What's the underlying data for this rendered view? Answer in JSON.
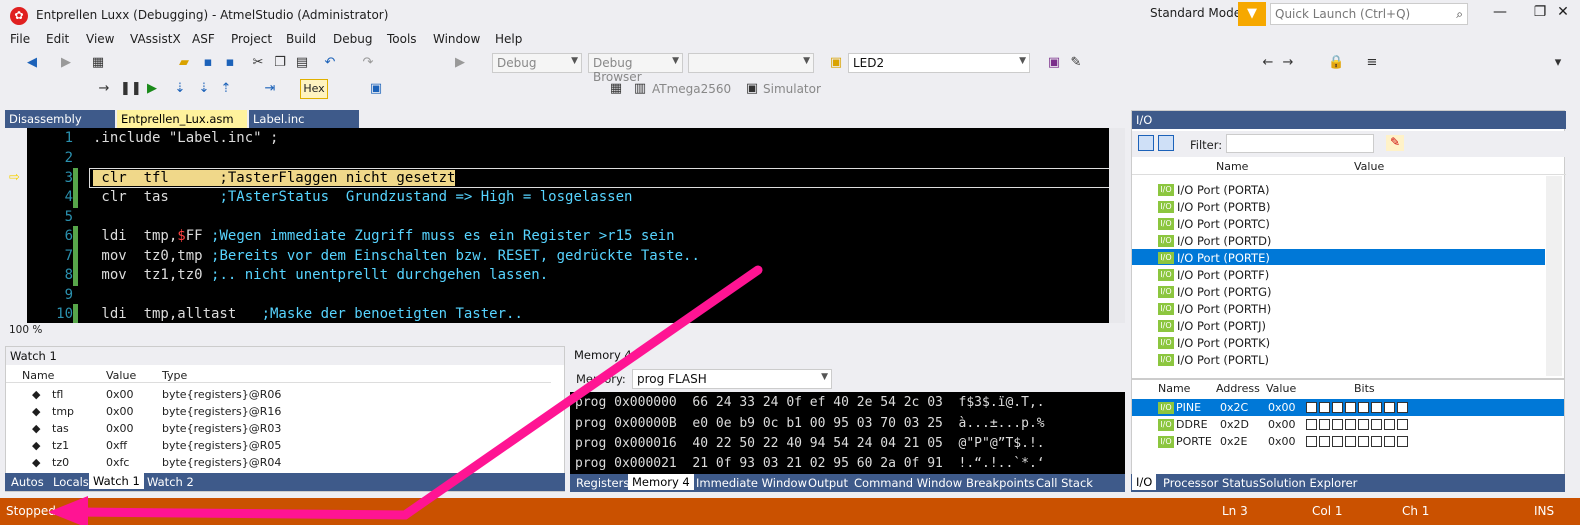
{
  "window": {
    "title": "Entprellen Luxx (Debugging) - AtmelStudio (Administrator)",
    "mode": "Standard Mode",
    "quick_launch": "Quick Launch (Ctrl+Q)"
  },
  "menu": [
    "File",
    "Edit",
    "View",
    "VAssistX",
    "ASF",
    "Project",
    "Build",
    "Debug",
    "Tools",
    "Window",
    "Help"
  ],
  "toolbar": {
    "config": "Debug",
    "browser": "Debug Browser",
    "target": "LED2",
    "hex": "Hex",
    "device": "ATmega2560",
    "tool": "Simulator"
  },
  "tabs": [
    "Disassembly",
    "Entprellen_Lux.asm",
    "Label.inc"
  ],
  "editor": {
    "zoom": "100 %",
    "lines": [
      {
        "n": "1",
        "t": ".include \"Label.inc\" ;"
      },
      {
        "n": "2",
        "t": ""
      },
      {
        "n": "3",
        "t": " clr  tfl      ;TasterFlaggen nicht gesetzt"
      },
      {
        "n": "4",
        "t": " clr  tas      ;TAsterStatus  Grundzustand => High = losgelassen"
      },
      {
        "n": "5",
        "t": ""
      },
      {
        "n": "6",
        "t": " ldi  tmp,$FF ;Wegen immediate Zugriff muss es ein Register >r15 sein"
      },
      {
        "n": "7",
        "t": " mov  tz0,tmp ;Bereits vor dem Einschalten bzw. RESET, gedrückte Taste.."
      },
      {
        "n": "8",
        "t": " mov  tz1,tz0 ;.. nicht unentprellt durchgehen lassen."
      },
      {
        "n": "9",
        "t": ""
      },
      {
        "n": "10",
        "t": " ldi  tmp,alltast   ;Maske der benoetigten Taster.."
      }
    ]
  },
  "watch": {
    "title": "Watch 1",
    "headers": [
      "Name",
      "Value",
      "Type"
    ],
    "rows": [
      [
        "tfl",
        "0x00",
        "byte{registers}@R06"
      ],
      [
        "tmp",
        "0x00",
        "byte{registers}@R16"
      ],
      [
        "tas",
        "0x00",
        "byte{registers}@R03"
      ],
      [
        "tz1",
        "0xff",
        "byte{registers}@R05"
      ],
      [
        "tz0",
        "0xfc",
        "byte{registers}@R04"
      ]
    ],
    "tabs": [
      "Autos",
      "Locals",
      "Watch 1",
      "Watch 2"
    ]
  },
  "memory": {
    "title": "Memory 4",
    "label": "Memory:",
    "space": "prog FLASH",
    "rows": [
      "prog 0x000000  66 24 33 24 0f ef 40 2e 54 2c 03  f$3$.ï@.T,.",
      "prog 0x00000B  e0 0e b9 0c b1 00 95 03 70 03 25  à...±...p.%",
      "prog 0x000016  40 22 50 22 40 94 54 24 04 21 05  @\"P\"@”T$.!.",
      "prog 0x000021  21 0f 93 03 21 02 95 60 2a 0f 91  !.“.!..`*.‘"
    ],
    "tabs": [
      "Registers",
      "Memory 4",
      "Immediate Window",
      "Output",
      "Command Window",
      "Breakpoints",
      "Call Stack"
    ]
  },
  "io": {
    "title": "I/O",
    "filter_label": "Filter:",
    "headers": [
      "Name",
      "Value"
    ],
    "ports": [
      "I/O Port (PORTA)",
      "I/O Port (PORTB)",
      "I/O Port (PORTC)",
      "I/O Port (PORTD)",
      "I/O Port (PORTE)",
      "I/O Port (PORTF)",
      "I/O Port (PORTG)",
      "I/O Port (PORTH)",
      "I/O Port (PORTJ)",
      "I/O Port (PORTK)",
      "I/O Port (PORTL)"
    ],
    "reg_headers": [
      "Name",
      "Address",
      "Value",
      "Bits"
    ],
    "regs": [
      [
        "PINE",
        "0x2C",
        "0x00"
      ],
      [
        "DDRE",
        "0x2D",
        "0x00"
      ],
      [
        "PORTE",
        "0x2E",
        "0x00"
      ]
    ],
    "tabs": [
      "I/O",
      "Processor Status",
      "Solution Explorer"
    ]
  },
  "status": {
    "state": "Stopped",
    "ln": "Ln 3",
    "col": "Col 1",
    "ch": "Ch 1",
    "ins": "INS"
  }
}
